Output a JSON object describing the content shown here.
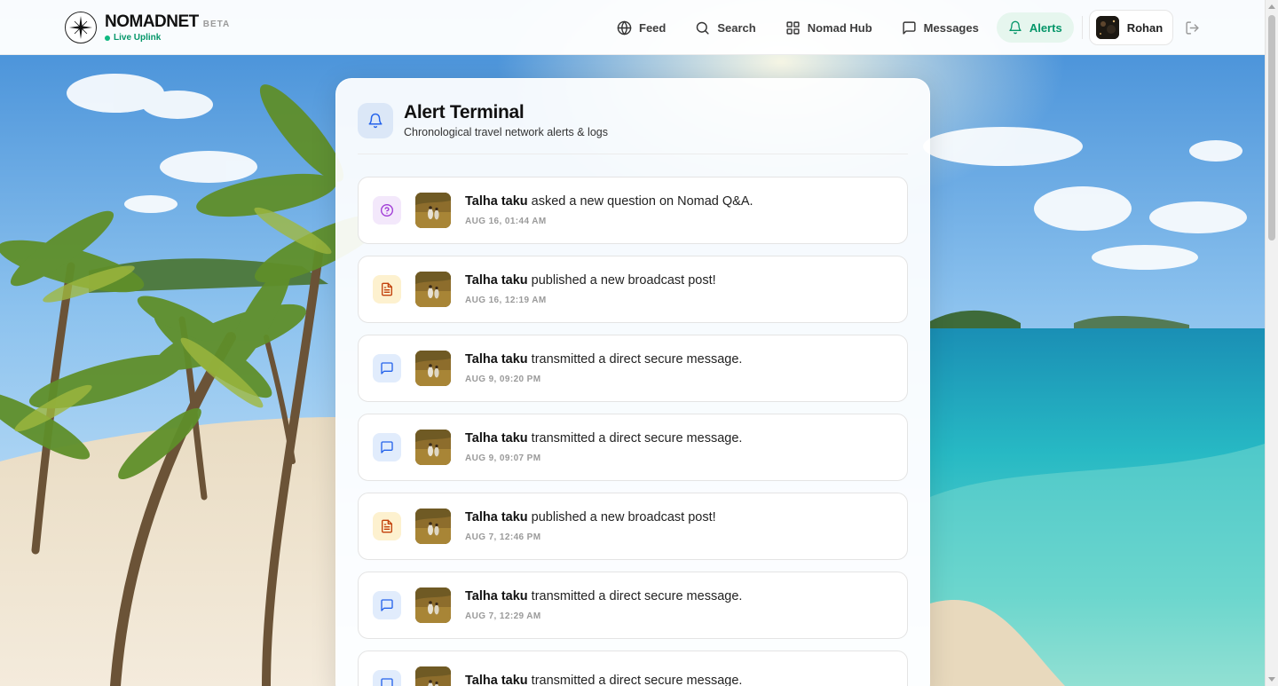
{
  "brand": {
    "name": "NOMADNET",
    "beta": "BETA",
    "status": "Live Uplink"
  },
  "nav": {
    "items": [
      {
        "label": "Feed",
        "icon": "globe-icon",
        "active": false
      },
      {
        "label": "Search",
        "icon": "search-icon",
        "active": false
      },
      {
        "label": "Nomad Hub",
        "icon": "grid-icon",
        "active": false
      },
      {
        "label": "Messages",
        "icon": "message-icon",
        "active": false
      },
      {
        "label": "Alerts",
        "icon": "bell-icon",
        "active": true
      }
    ],
    "user": {
      "name": "Rohan"
    },
    "logout_icon": "logout-icon"
  },
  "panel": {
    "title": "Alert Terminal",
    "subtitle": "Chronological travel network alerts & logs",
    "icon": "bell-icon"
  },
  "alerts": [
    {
      "type": "question",
      "user": "Talha taku",
      "action": " asked a new question on Nomad Q&A.",
      "time": "AUG 16, 01:44 AM"
    },
    {
      "type": "post",
      "user": "Talha taku",
      "action": " published a new broadcast post!",
      "time": "AUG 16, 12:19 AM"
    },
    {
      "type": "message",
      "user": "Talha taku",
      "action": " transmitted a direct secure message.",
      "time": "AUG 9, 09:20 PM"
    },
    {
      "type": "message",
      "user": "Talha taku",
      "action": " transmitted a direct secure message.",
      "time": "AUG 9, 09:07 PM"
    },
    {
      "type": "post",
      "user": "Talha taku",
      "action": " published a new broadcast post!",
      "time": "AUG 7, 12:46 PM"
    },
    {
      "type": "message",
      "user": "Talha taku",
      "action": " transmitted a direct secure message.",
      "time": "AUG 7, 12:29 AM"
    },
    {
      "type": "message",
      "user": "Talha taku",
      "action": " transmitted a direct secure message.",
      "time": ""
    }
  ],
  "colors": {
    "accent": "#059669",
    "active_bg": "#e6f6ee",
    "question_icon": "#a03bd6",
    "post_icon": "#c2410c",
    "message_icon": "#2563eb"
  }
}
